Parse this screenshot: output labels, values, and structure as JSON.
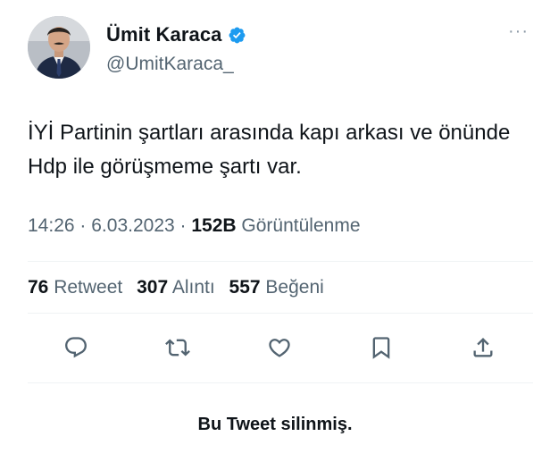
{
  "author": {
    "display_name": "Ümit Karaca",
    "handle": "@UmitKaraca_",
    "verified_badge_icon": "verified-badge-icon",
    "accent_color": "#1d9bf0"
  },
  "tweet": {
    "text": "İYİ Partinin şartları arasında kapı arkası ve önünde Hdp ile görüşmeme şartı var.",
    "time": "14:26",
    "separator": "·",
    "date": "6.03.2023",
    "views_count": "152B",
    "views_label": "Görüntülenme"
  },
  "stats": {
    "retweets": {
      "count": "76",
      "label": "Retweet"
    },
    "quotes": {
      "count": "307",
      "label": "Alıntı"
    },
    "likes": {
      "count": "557",
      "label": "Beğeni"
    }
  },
  "actions": [
    {
      "icon": "reply-icon"
    },
    {
      "icon": "retweet-icon"
    },
    {
      "icon": "like-icon"
    },
    {
      "icon": "bookmark-icon"
    },
    {
      "icon": "share-icon"
    }
  ],
  "more_menu": {
    "label": "···"
  },
  "notice": {
    "text": "Bu Tweet silinmiş."
  }
}
